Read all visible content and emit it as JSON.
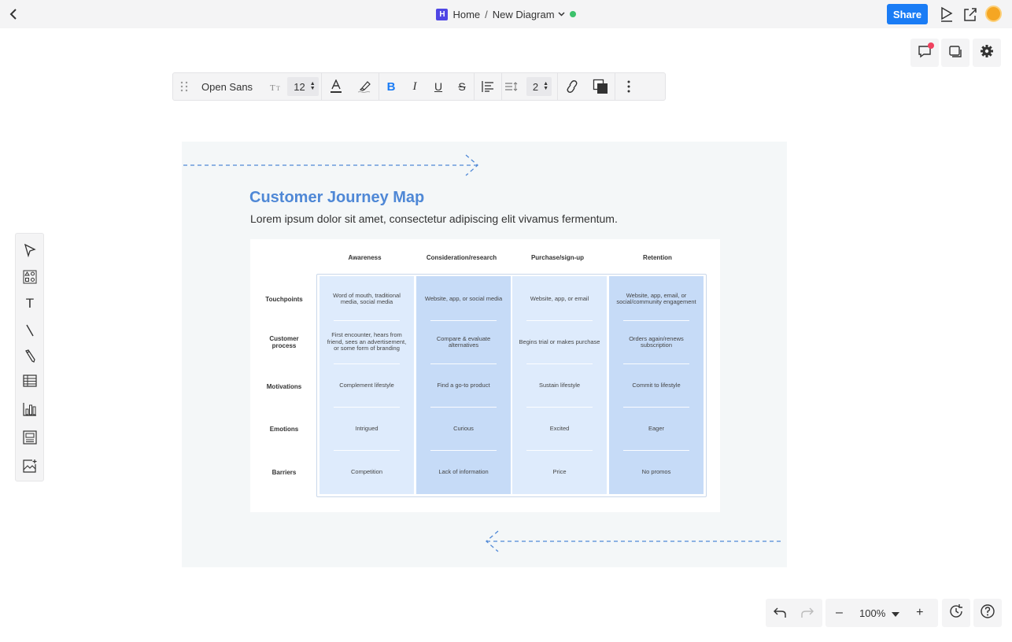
{
  "topbar": {
    "app_logo": "H",
    "home": "Home",
    "separator": "/",
    "doc_title": "New Diagram",
    "share_label": "Share"
  },
  "toolbar": {
    "font_name": "Open Sans",
    "font_size": "12",
    "line_spacing": "2"
  },
  "map": {
    "title": "Customer Journey Map",
    "subtitle": "Lorem ipsum dolor sit amet, consectetur adipiscing elit vivamus fermentum.",
    "columns": [
      "Awareness",
      "Consideration/research",
      "Purchase/sign-up",
      "Retention"
    ],
    "rows": [
      "Touchpoints",
      "Customer process",
      "Motivations",
      "Emotions",
      "Barriers"
    ],
    "cells": [
      [
        "Word of mouth, traditional media, social media",
        "First encounter, hears from friend, sees an advertisement, or some form of branding",
        "Complement lifestyle",
        "Intrigued",
        "Competition"
      ],
      [
        "Website, app, or social media",
        "Compare & evaluate alternatives",
        "Find a go-to product",
        "Curious",
        "Lack of information"
      ],
      [
        "Website, app, or email",
        "Begins trial or makes purchase",
        "Sustain lifestyle",
        "Excited",
        "Price"
      ],
      [
        "Website, app, email, or social/community engagement",
        "Orders again/renews subscription",
        "Commit to lifestyle",
        "Eager",
        "No promos"
      ]
    ],
    "column_colors": [
      "#deebfc",
      "#c6dbf7",
      "#deebfc",
      "#c6dbf7"
    ]
  },
  "zoom": {
    "minus": "–",
    "value": "100%",
    "plus": "+"
  },
  "colors": {
    "accent": "#1a7cf5",
    "title_blue": "#4f88d6",
    "arrow_blue": "#4f88d6"
  }
}
